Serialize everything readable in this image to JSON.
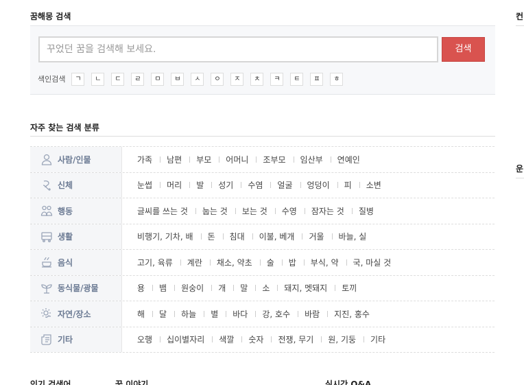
{
  "search_section": {
    "title": "꿈해몽 검색",
    "placeholder": "꾸었던 꿈을 검색해 보세요.",
    "button": "검색",
    "index_label": "색인검색",
    "index_keys": [
      "ㄱ",
      "ㄴ",
      "ㄷ",
      "ㄹ",
      "ㅁ",
      "ㅂ",
      "ㅅ",
      "ㅇ",
      "ㅈ",
      "ㅊ",
      "ㅋ",
      "ㅌ",
      "ㅍ",
      "ㅎ"
    ]
  },
  "frequent_section": {
    "title": "자주 찾는 검색 분류",
    "categories": [
      {
        "name": "사람/인물",
        "icon": "person-icon",
        "items": [
          "가족",
          "남편",
          "부모",
          "어머니",
          "조부모",
          "임산부",
          "연예인"
        ]
      },
      {
        "name": "신체",
        "icon": "body-icon",
        "items": [
          "눈썹",
          "머리",
          "발",
          "성기",
          "수염",
          "얼굴",
          "엉덩이",
          "피",
          "소변"
        ]
      },
      {
        "name": "행동",
        "icon": "action-icon",
        "items": [
          "글씨를 쓰는 것",
          "눕는 것",
          "보는 것",
          "수영",
          "잠자는 것",
          "질병"
        ]
      },
      {
        "name": "생활",
        "icon": "car-icon",
        "items": [
          "비행기, 기차, 배",
          "돈",
          "침대",
          "이불, 베개",
          "거울",
          "바늘, 실"
        ]
      },
      {
        "name": "음식",
        "icon": "food-icon",
        "items": [
          "고기, 육류",
          "계란",
          "채소, 약초",
          "술",
          "밥",
          "부식, 약",
          "국, 마실 것"
        ]
      },
      {
        "name": "동식물/광물",
        "icon": "plant-icon",
        "items": [
          "용",
          "뱀",
          "원숭이",
          "개",
          "말",
          "소",
          "돼지, 멧돼지",
          "토끼"
        ]
      },
      {
        "name": "자연/장소",
        "icon": "nature-icon",
        "items": [
          "해",
          "달",
          "하늘",
          "별",
          "바다",
          "강, 호수",
          "바람",
          "지진, 홍수"
        ]
      },
      {
        "name": "기타",
        "icon": "scroll-icon",
        "items": [
          "오행",
          "십이별자리",
          "색깔",
          "숫자",
          "전쟁, 무기",
          "원, 기둥",
          "기타"
        ]
      }
    ]
  },
  "bottom": {
    "popular_title": "인기 검색어",
    "story_title": "꿈 이야기",
    "qa_title": "실시간 Q&A"
  },
  "side": {
    "title_top": "컨",
    "title_mid": "운"
  }
}
